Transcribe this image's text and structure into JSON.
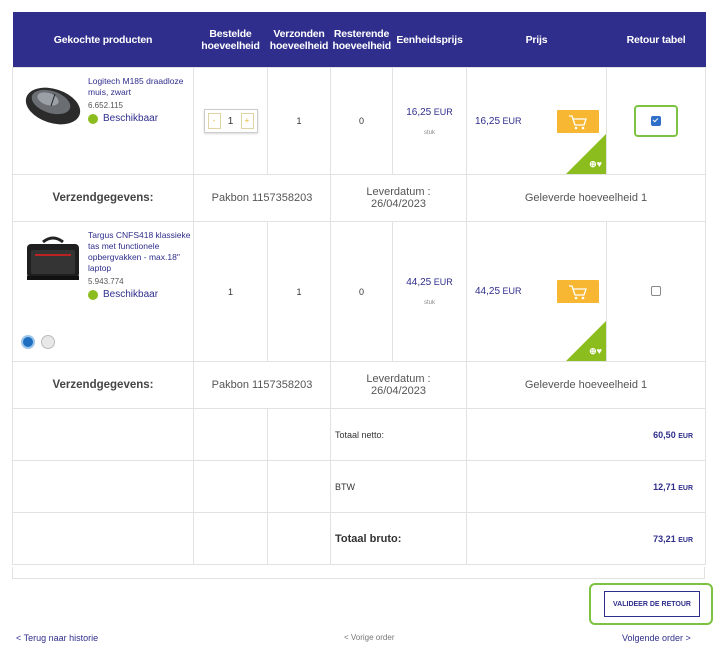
{
  "headers": [
    "Gekochte producten",
    "Bestelde hoeveelheid",
    "Verzonden hoeveelheid",
    "Resterende hoeveelheid",
    "Eenheidsprijs",
    "Prijs",
    "Retour tabel"
  ],
  "products": [
    {
      "name": "Logitech M185 draadloze muis, zwart",
      "sku": "6.652.115",
      "availability": "Beschikbaar",
      "ordered": "1",
      "shipped": "1",
      "remaining": "0",
      "unit_price_main": "16,25",
      "unit_price_cur": "EUR",
      "unit_label": "stuk",
      "price_main": "16,25",
      "price_cur": "EUR",
      "return_checked": true
    },
    {
      "name": "Targus CNFS418 klassieke tas met functionele opbergvakken - max.18\" laptop",
      "sku": "5.943.774",
      "availability": "Beschikbaar",
      "ordered": "1",
      "shipped": "1",
      "remaining": "0",
      "unit_price_main": "44,25",
      "unit_price_cur": "EUR",
      "unit_label": "stuk",
      "price_main": "44,25",
      "price_cur": "EUR",
      "return_checked": false
    }
  ],
  "shipping": [
    {
      "label": "Verzendgegevens:",
      "pakbon": "Pakbon 1157358203",
      "leverdatum": "Leverdatum :",
      "date": "26/04/2023",
      "delivered": "Geleverde hoeveelheid 1"
    },
    {
      "label": "Verzendgegevens:",
      "pakbon": "Pakbon 1157358203",
      "leverdatum": "Leverdatum :",
      "date": "26/04/2023",
      "delivered": "Geleverde hoeveelheid 1"
    }
  ],
  "totals": {
    "netto_label": "Totaal netto:",
    "netto_value": "60,50",
    "netto_cur": "EUR",
    "btw_label": "BTW",
    "btw_value": "12,71",
    "btw_cur": "EUR",
    "bruto_label": "Totaal bruto:",
    "bruto_value": "73,21",
    "bruto_cur": "EUR"
  },
  "validate_button": "VALIDEER DE RETOUR",
  "nav": {
    "back": "< Terug naar historie",
    "prev": "< Vorige order",
    "next": "Volgende order >"
  },
  "icons": {
    "cart": "cart-icon",
    "compare_favorite": "plus-heart-icon",
    "globe": "globe-icon",
    "wheelchair": "accessibility-icon"
  },
  "colors": {
    "header_bg": "#2f2e8c",
    "accent_orange": "#f7b733",
    "accent_green": "#8bbd1e",
    "highlight_green": "#7dc242"
  }
}
